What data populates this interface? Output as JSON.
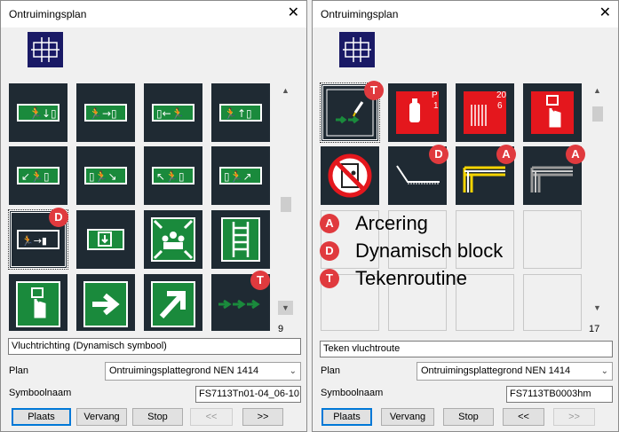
{
  "left": {
    "title": "Ontruimingsplan",
    "count": "9",
    "description": "Vluchtrichting (Dynamisch symbool)",
    "plan_label": "Plan",
    "plan_value": "Ontruimingsplattegrond NEN 1414",
    "symbol_label": "Symboolnaam",
    "symbol_value": "FS7113Tn01-04_06-10",
    "badges": {
      "selected": "D",
      "draw": "T"
    },
    "buttons": {
      "place": "Plaats",
      "replace": "Vervang",
      "stop": "Stop",
      "prev": "<<",
      "next": ">>"
    }
  },
  "right": {
    "title": "Ontruimingsplan",
    "count": "17",
    "description": "Teken vluchtroute",
    "plan_label": "Plan",
    "plan_value": "Ontruimingsplattegrond NEN 1414",
    "symbol_label": "Symboolnaam",
    "symbol_value": "FS7113TB0003hm",
    "tile_texts": {
      "hose_a": "P",
      "hose_b": "1",
      "reel_a": "20",
      "reel_b": "6"
    },
    "badges": {
      "t1": "T",
      "d1": "D",
      "a1": "A",
      "a2": "A"
    },
    "legend": [
      {
        "badge": "A",
        "text": "Arcering"
      },
      {
        "badge": "D",
        "text": "Dynamisch block"
      },
      {
        "badge": "T",
        "text": "Tekenroutine"
      }
    ],
    "buttons": {
      "place": "Plaats",
      "replace": "Vervang",
      "stop": "Stop",
      "prev": "<<",
      "next": ">>"
    }
  },
  "colors": {
    "badge": "#e03a3e",
    "tile": "#1f2a33",
    "logo": "#1a1a66",
    "red_sign": "#e4171d",
    "green_sign": "#1a8a3c"
  }
}
